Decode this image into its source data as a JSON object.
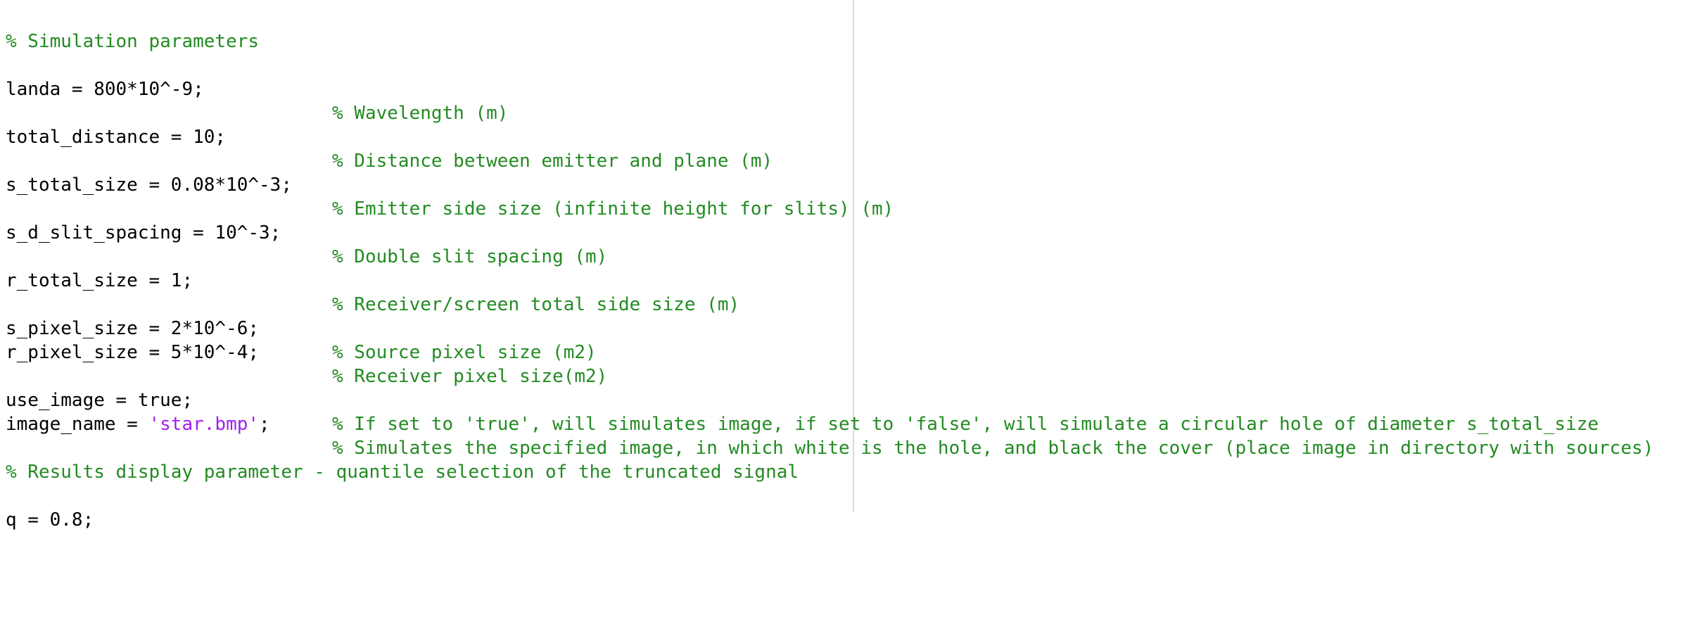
{
  "editor": {
    "lines": {
      "l0": {
        "comment": "% Simulation parameters"
      },
      "l1": {
        "code": "landa = 800*10^-9;",
        "comment": "% Wavelength (m)"
      },
      "l2": {
        "code": "total_distance = 10;",
        "comment": "% Distance between emitter and plane (m)"
      },
      "l3": {
        "code": "s_total_size = 0.08*10^-3;",
        "comment": "% Emitter side size (infinite height for slits) (m)"
      },
      "l4": {
        "code": "s_d_slit_spacing = 10^-3;",
        "comment": "% Double slit spacing (m)"
      },
      "l5": {
        "code": "r_total_size = 1;",
        "comment": "% Receiver/screen total side size (m)"
      },
      "l6": {
        "code": "s_pixel_size = 2*10^-6;",
        "comment": "% Source pixel size (m2)"
      },
      "l7": {
        "code": "r_pixel_size = 5*10^-4;",
        "comment": "% Receiver pixel size(m2)"
      },
      "l8": {
        "code": "use_image = true;",
        "comment": "% If set to 'true', will simulates image, if set to 'false', will simulate a circular hole of diameter s_total_size"
      },
      "l9": {
        "code_prefix": "image_name = ",
        "string": "'star.bmp'",
        "code_suffix": ";",
        "comment": "% Simulates the specified image, in which white is the hole, and black the cover (place image in directory with sources)"
      },
      "l10": {
        "comment": "% Results display parameter - quantile selection of the truncated signal"
      },
      "l11": {
        "code": "q = 0.8;"
      }
    },
    "colors": {
      "comment": "#228B22",
      "string": "#A020F0",
      "code": "#000000"
    }
  }
}
